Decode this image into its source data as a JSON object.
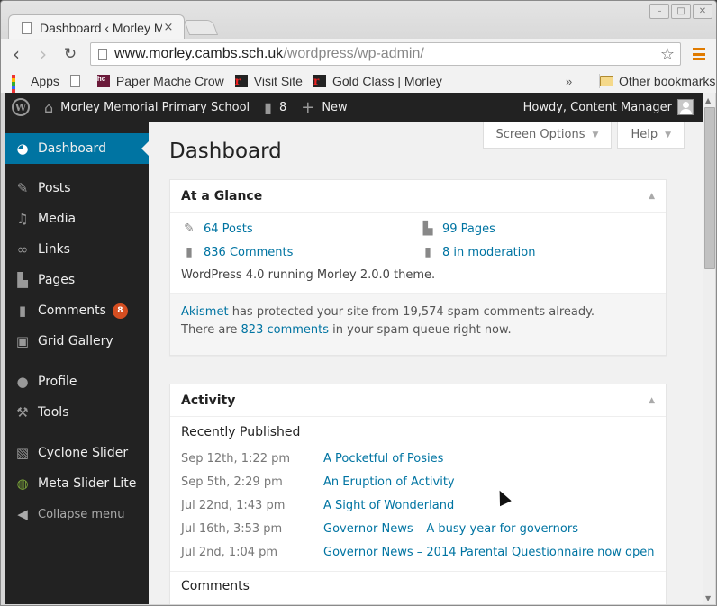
{
  "browser": {
    "tab_title": "Dashboard ‹ Morley M",
    "tab_close": "×",
    "url_host": "www.morley.cambs.sch.uk",
    "url_path": "/wordpress/wp-admin/",
    "window_buttons": {
      "minimize": "–",
      "maximize": "□",
      "close": "✕"
    },
    "bookmarks": [
      {
        "label": "Apps",
        "icon": "apps-grid-icon"
      },
      {
        "label": "",
        "icon": "page-icon"
      },
      {
        "label": "Paper Mache Crow",
        "icon": "hc-icon"
      },
      {
        "label": "Visit Site",
        "icon": "r-icon"
      },
      {
        "label": "Gold Class | Morley",
        "icon": "r-icon"
      }
    ],
    "bookmarks_overflow": "»",
    "other_bookmarks": "Other bookmarks"
  },
  "adminbar": {
    "site_name": "Morley Memorial Primary School",
    "comment_count": "8",
    "new_label": "New",
    "howdy": "Howdy, Content Manager"
  },
  "sidebar": {
    "items": [
      {
        "label": "Dashboard",
        "icon": "dashboard-icon",
        "active": true
      },
      {
        "label": "Posts",
        "icon": "pin-icon"
      },
      {
        "label": "Media",
        "icon": "media-icon"
      },
      {
        "label": "Links",
        "icon": "link-icon"
      },
      {
        "label": "Pages",
        "icon": "pages-icon"
      },
      {
        "label": "Comments",
        "icon": "comment-icon",
        "badge": "8"
      },
      {
        "label": "Grid Gallery",
        "icon": "gallery-icon"
      },
      {
        "label": "Profile",
        "icon": "user-icon"
      },
      {
        "label": "Tools",
        "icon": "wrench-icon"
      },
      {
        "label": "Cyclone Slider",
        "icon": "slider-icon"
      },
      {
        "label": "Meta Slider Lite",
        "icon": "meta-slider-icon"
      }
    ],
    "collapse_label": "Collapse menu"
  },
  "content": {
    "screen_options": "Screen Options",
    "help": "Help",
    "page_title": "Dashboard",
    "at_a_glance": {
      "title": "At a Glance",
      "posts": "64 Posts",
      "pages": "99 Pages",
      "comments": "836 Comments",
      "moderation": "8 in moderation",
      "version_text": "WordPress 4.0 running Morley 2.0.0 theme.",
      "akismet_link": "Akismet",
      "akismet_text1": " has protected your site from 19,574 spam comments already.",
      "akismet_text2_pre": "There are ",
      "akismet_link2": "823 comments",
      "akismet_text2_post": " in your spam queue right now."
    },
    "activity": {
      "title": "Activity",
      "recently_published": "Recently Published",
      "posts": [
        {
          "date": "Sep 12th, 1:22 pm",
          "title": "A Pocketful of Posies"
        },
        {
          "date": "Sep 5th, 2:29 pm",
          "title": "An Eruption of Activity"
        },
        {
          "date": "Jul 22nd, 1:43 pm",
          "title": "A Sight of Wonderland"
        },
        {
          "date": "Jul 16th, 3:53 pm",
          "title": "Governor News – A busy year for governors"
        },
        {
          "date": "Jul 2nd, 1:04 pm",
          "title": "Governor News – 2014 Parental Questionnaire now open"
        }
      ],
      "comments_heading": "Comments"
    }
  }
}
